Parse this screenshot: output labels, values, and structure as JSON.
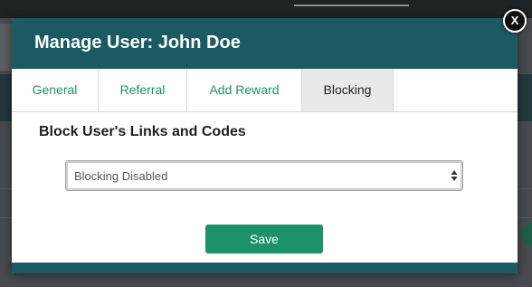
{
  "modal": {
    "title": "Manage User: John Doe",
    "close_label": "X",
    "tabs": [
      {
        "label": "General",
        "active": false
      },
      {
        "label": "Referral",
        "active": false
      },
      {
        "label": "Add Reward",
        "active": false
      },
      {
        "label": "Blocking",
        "active": true
      }
    ],
    "section_title": "Block User's Links and Codes",
    "blocking_select": {
      "selected": "Blocking Disabled"
    },
    "save_label": "Save"
  },
  "colors": {
    "header": "#1b5a62",
    "accent": "#1c9366",
    "tab_text": "#1f9165",
    "active_tab_bg": "#e9e9e9"
  }
}
